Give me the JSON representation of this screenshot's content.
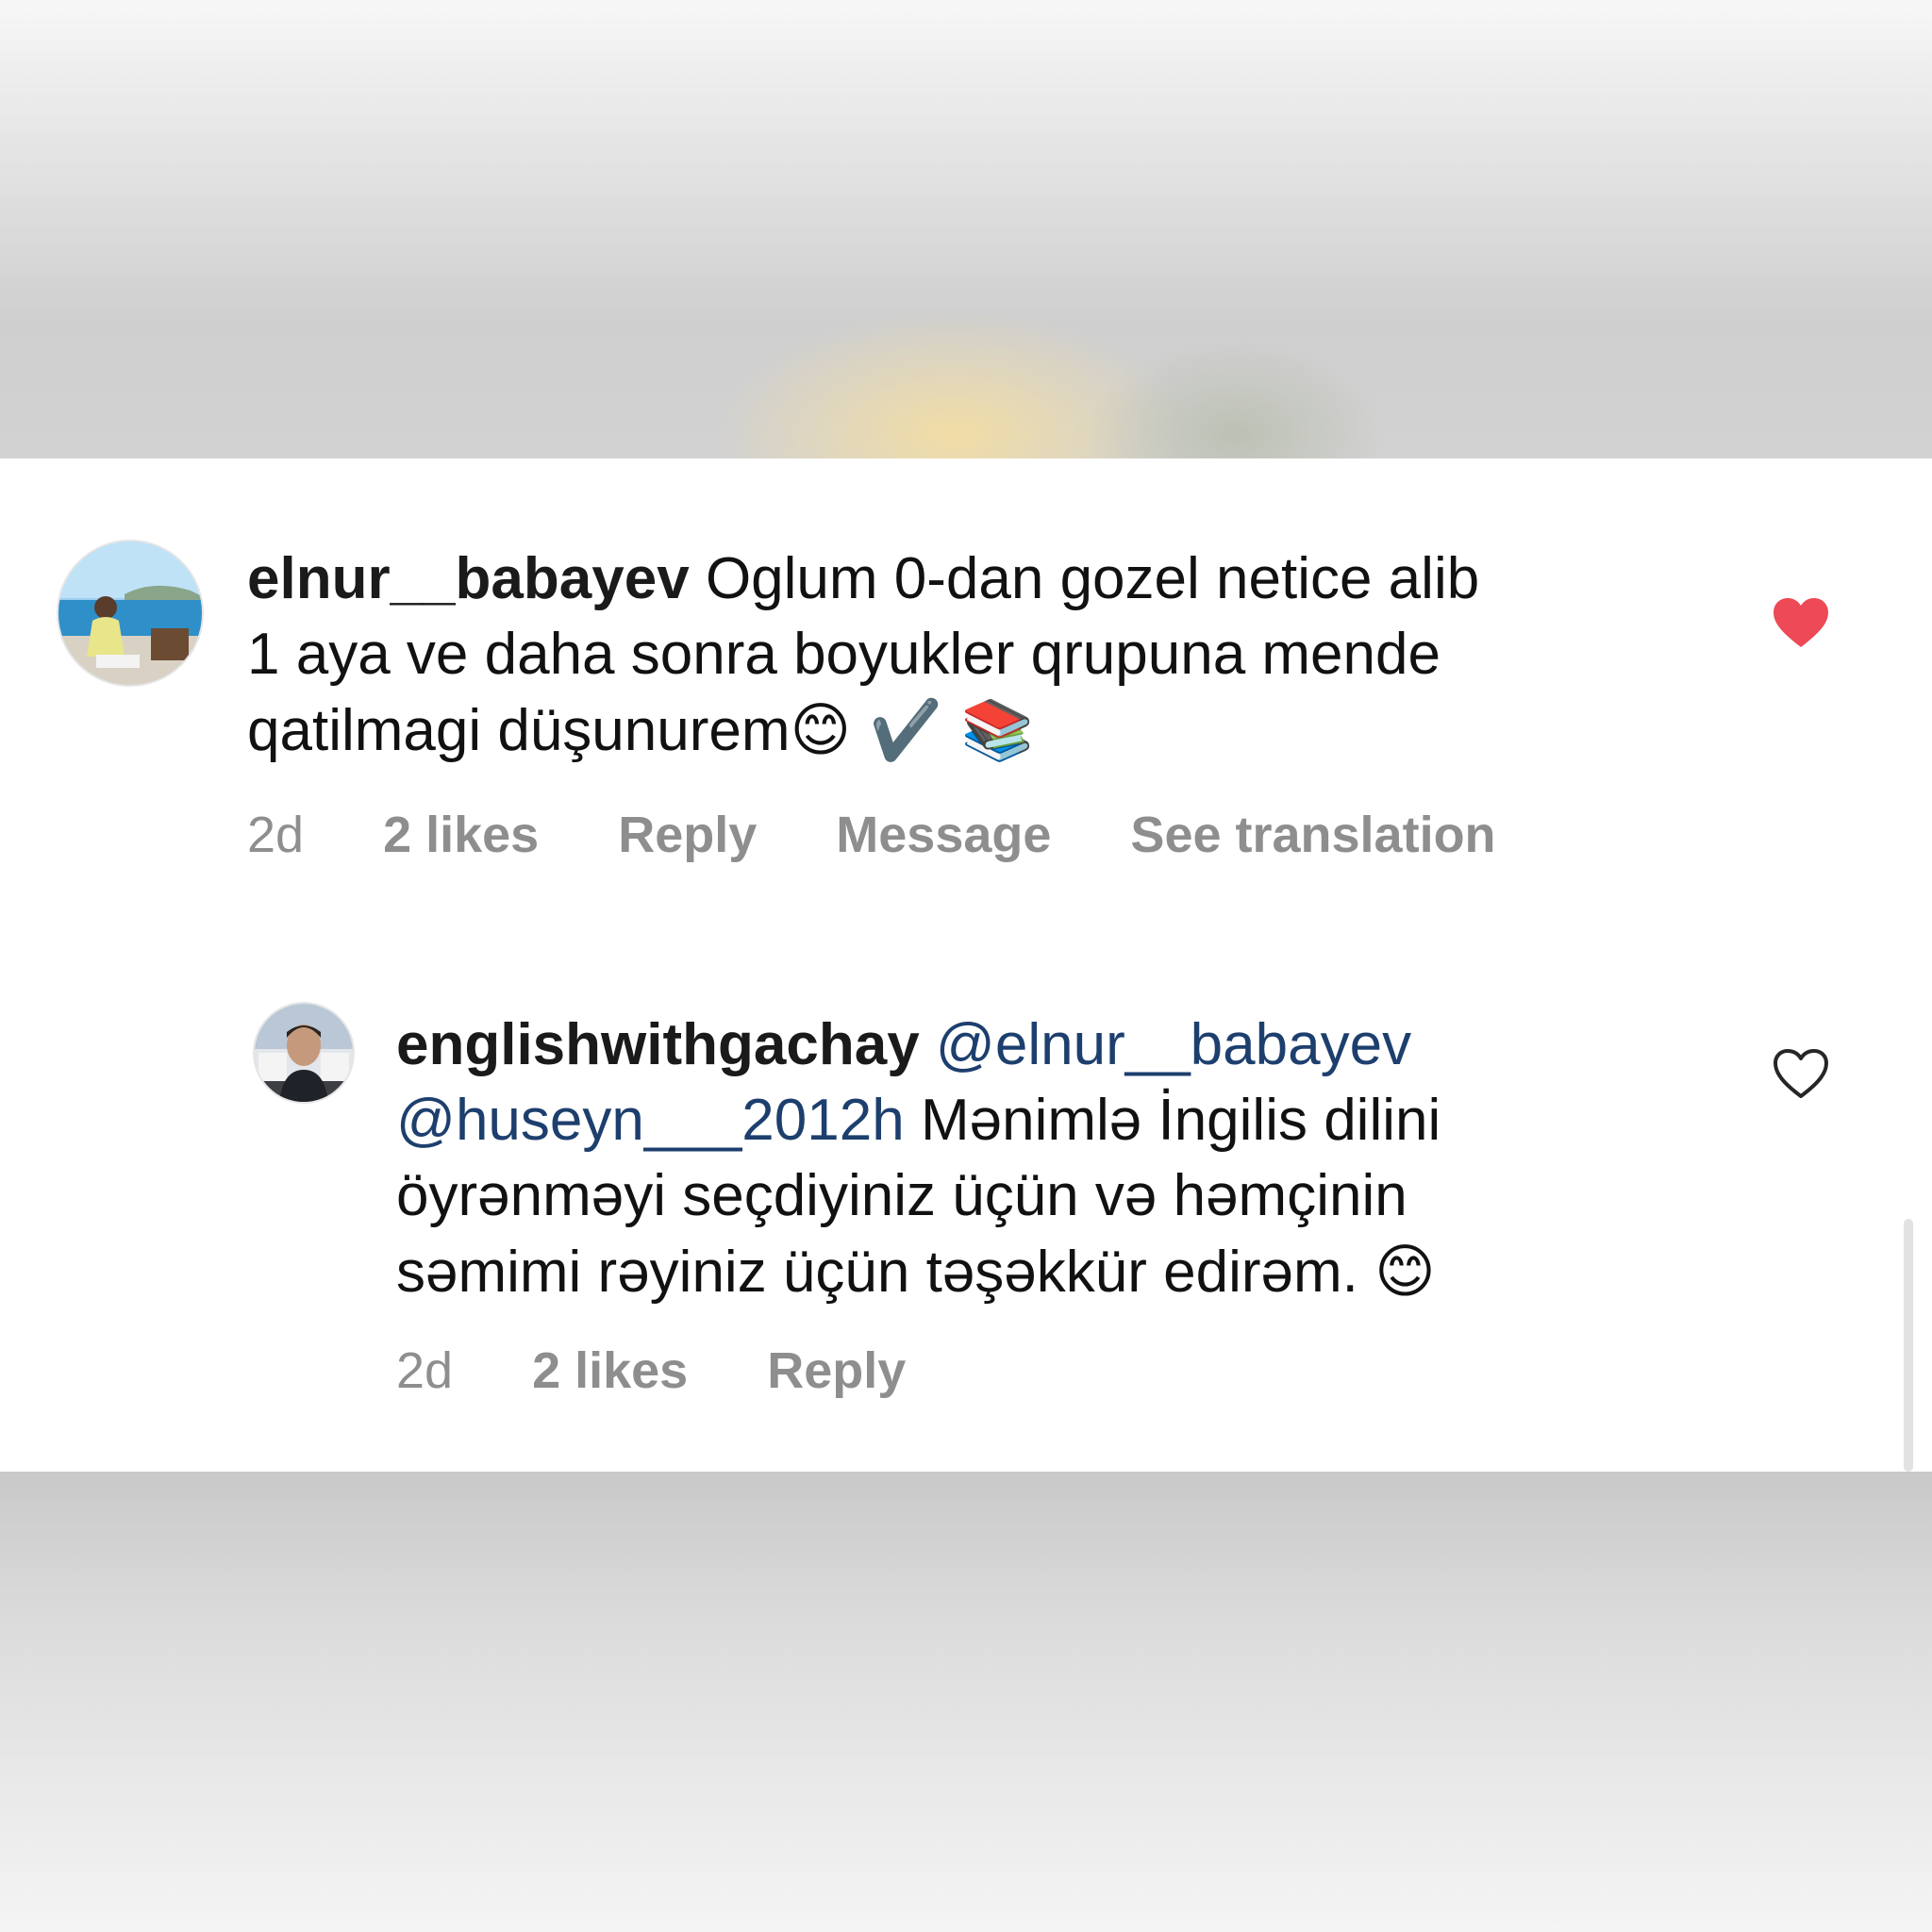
{
  "comments": [
    {
      "username": "elnur__babayev",
      "line1": "Oglum 0-dan gozel netice alib",
      "line2": "1 aya ve daha sonra boyukler qrupuna mende",
      "line3": "qatilmagi düşunurem",
      "emojis": "😊 ✔️ 📚",
      "time": "2d",
      "likes": "2 likes",
      "reply": "Reply",
      "message": "Message",
      "see_translation": "See translation",
      "liked": true,
      "heart_color": "#ed4956"
    },
    {
      "username": "englishwithgachay",
      "mention1": "@elnur__babayev",
      "mention2": "@huseyn___2012h",
      "line2_text": "Mənimlə İngilis dilini",
      "line3": "öyrənməyi seçdiyiniz üçün və həmçinin",
      "line4": "səmimi rəyiniz üçün təşəkkür edirəm.",
      "emoji": "😊",
      "time": "2d",
      "likes": "2 likes",
      "reply": "Reply",
      "liked": false
    }
  ],
  "colors": {
    "mention": "#1d3f6e",
    "meta_text": "#8e8e8e",
    "like_red": "#ed4956"
  },
  "icons": [
    "avatar-photo",
    "heart-filled-icon",
    "heart-outline-icon"
  ]
}
